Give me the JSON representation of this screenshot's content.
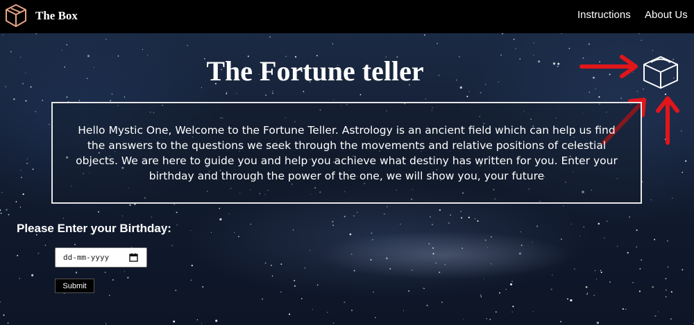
{
  "navbar": {
    "brand_name": "The Box",
    "logo_icon": "box-icon",
    "links": [
      {
        "label": "Instructions"
      },
      {
        "label": "About Us"
      }
    ]
  },
  "main": {
    "title": "The Fortune teller",
    "intro_text": "Hello Mystic One, Welcome to the Fortune Teller. Astrology is an ancient field which can help us find the answers to the questions we seek through the movements and relative positions of celestial objects. We are here to guide you and help you achieve what destiny has written for you. Enter your birthday and through the power of the one, we will show you, your future",
    "birthday_label": "Please Enter your Birthday:",
    "date_placeholder": "dd-mm-yyyy",
    "submit_label": "Submit"
  },
  "colors": {
    "logo_accent": "#e8a58a",
    "annotation_arrows": "#e0161b",
    "navbar_bg": "#000000"
  }
}
